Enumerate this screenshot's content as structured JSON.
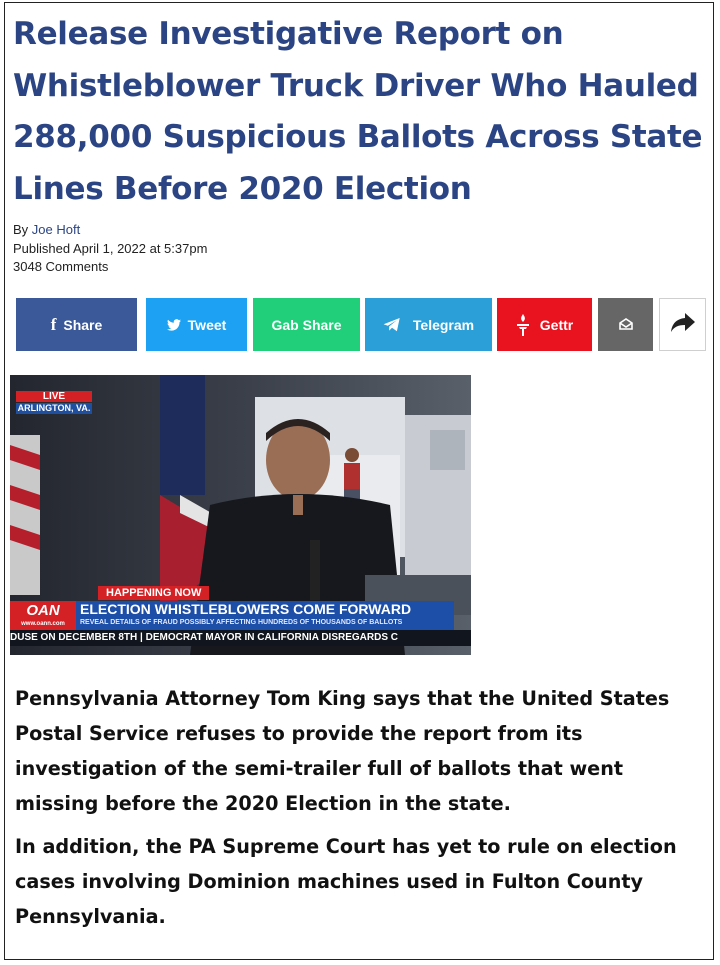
{
  "article": {
    "title": "Release Investigative Report on Whistleblower Truck Driver Who Hauled 288,000 Suspicious Ballots Across State Lines Before 2020 Election",
    "by_label": "By",
    "author": "Joe Hoft",
    "published": "Published April 1, 2022 at 5:37pm",
    "comments": "3048 Comments"
  },
  "share_buttons": [
    {
      "label": "Share",
      "icon": "facebook-icon",
      "color": "#3b5998"
    },
    {
      "label": "Tweet",
      "icon": "twitter-icon",
      "color": "#1da1f2"
    },
    {
      "label": "Gab Share",
      "icon": "",
      "color": "#21cf7a"
    },
    {
      "label": "Telegram",
      "icon": "telegram-icon",
      "color": "#2a9fd8"
    },
    {
      "label": "Gettr",
      "icon": "gettr-icon",
      "color": "#e8131f"
    },
    {
      "label": "",
      "icon": "email-icon",
      "color": "#666666"
    },
    {
      "label": "",
      "icon": "share-arrow-icon",
      "color": "#ffffff"
    }
  ],
  "video": {
    "live": "LIVE",
    "location": "ARLINGTON, VA.",
    "happening": "HAPPENING NOW",
    "network": "OAN",
    "network_url": "www.oann.com",
    "headline": "ELECTION WHISTLEBLOWERS COME FORWARD",
    "subheadline": "REVEAL DETAILS OF FRAUD POSSIBLY AFFECTING HUNDREDS OF THOUSANDS OF BALLOTS",
    "ticker": "DUSE ON DECEMBER 8TH  |  DEMOCRAT MAYOR IN CALIFORNIA DISREGARDS C"
  },
  "paragraphs": [
    "Pennsylvania Attorney Tom King says that the United States Postal Service refuses to provide the report from its investigation of the semi-trailer full of ballots that went missing before the 2020 Election in the state.",
    "In addition, the PA Supreme Court has yet to rule on election cases involving Dominion machines used in Fulton County Pennsylvania."
  ]
}
